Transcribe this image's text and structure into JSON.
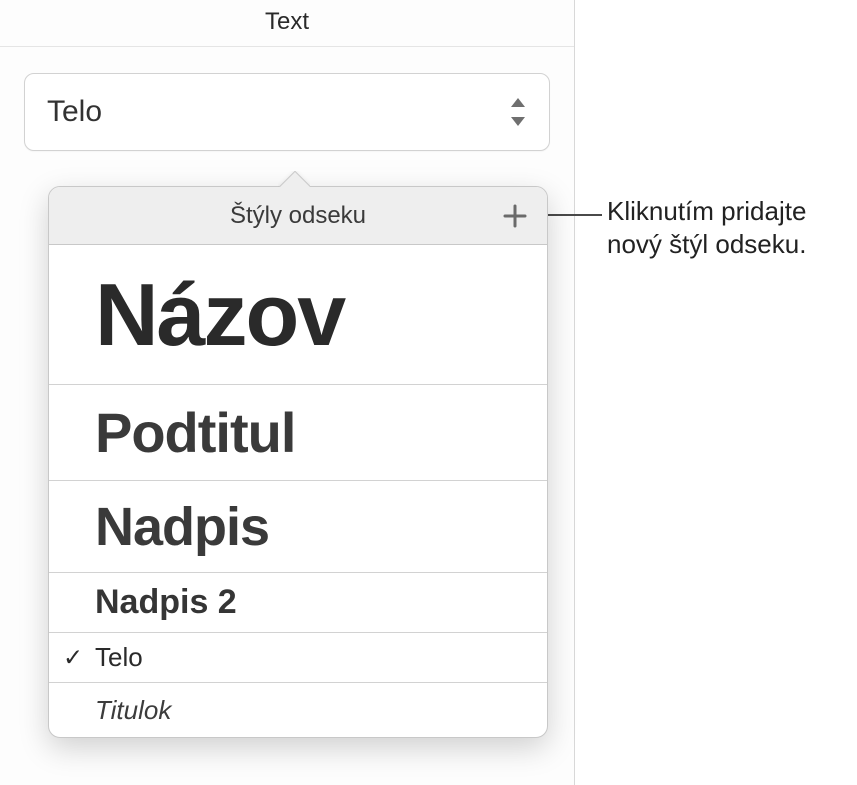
{
  "panel": {
    "title": "Text"
  },
  "style_select": {
    "current": "Telo"
  },
  "popover": {
    "title": "Štýly odseku",
    "items": {
      "title": "Názov",
      "subtitle": "Podtitul",
      "heading": "Nadpis",
      "heading2": "Nadpis 2",
      "body": "Telo",
      "caption": "Titulok"
    },
    "selected_index": 4
  },
  "callout": {
    "text": "Kliknutím pridajte nový štýl odseku."
  }
}
